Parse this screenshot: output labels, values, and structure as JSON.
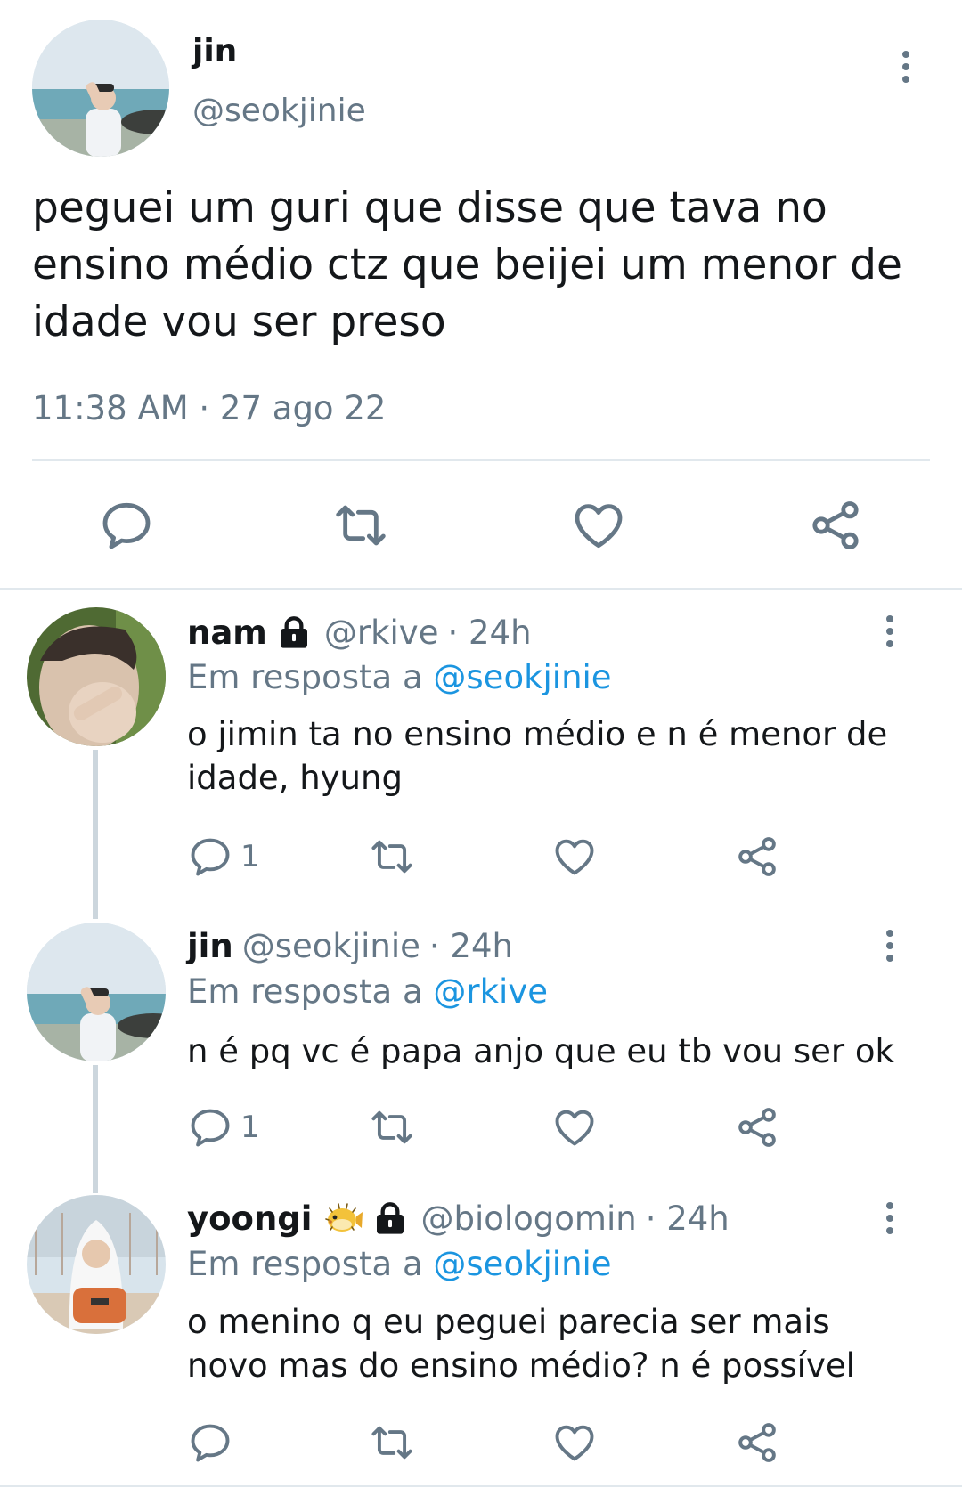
{
  "tweet": {
    "name": "jin",
    "handle": "@seokjinie",
    "text_lines": [
      "peguei um guri que disse que tava no",
      "ensino médio ctz que beijei um menor de",
      "idade vou ser preso"
    ],
    "time": "11:38 AM",
    "date": "27 ago 22",
    "sep": "·"
  },
  "replies": [
    {
      "name": "nam",
      "badges": [
        "lock-icon"
      ],
      "handle": "@rkive",
      "age": "· 24h",
      "reply_prefix": "Em resposta a",
      "reply_to": "@seokjinie",
      "text_lines": [
        "o jimin ta no ensino médio e n é menor de",
        "idade, hyung"
      ],
      "reply_count": "1"
    },
    {
      "name": "jin",
      "badges": [],
      "handle": "@seokjinie",
      "age": "· 24h",
      "reply_prefix": "Em resposta a",
      "reply_to": "@rkive",
      "text_lines": [
        "n é pq vc é papa anjo que eu tb vou ser ok"
      ],
      "reply_count": "1"
    },
    {
      "name": "yoongi",
      "badges": [
        "pufferfish-emoji-icon",
        "lock-icon"
      ],
      "handle": "@biologomin",
      "age": "· 24h",
      "reply_prefix": "Em resposta a",
      "reply_to": "@seokjinie",
      "text_lines": [
        "o menino q eu peguei parecia ser mais",
        "novo mas do ensino médio? n é possível"
      ],
      "reply_count": ""
    }
  ],
  "colors": {
    "text": "#14171a",
    "muted": "#657786",
    "link": "#1b95e0",
    "divider": "#e1e8ed",
    "thread_line": "#ccd6dd"
  },
  "icons": [
    "comment-icon",
    "retweet-icon",
    "heart-icon",
    "share-icon",
    "more-options-icon",
    "lock-icon",
    "pufferfish-emoji-icon"
  ]
}
